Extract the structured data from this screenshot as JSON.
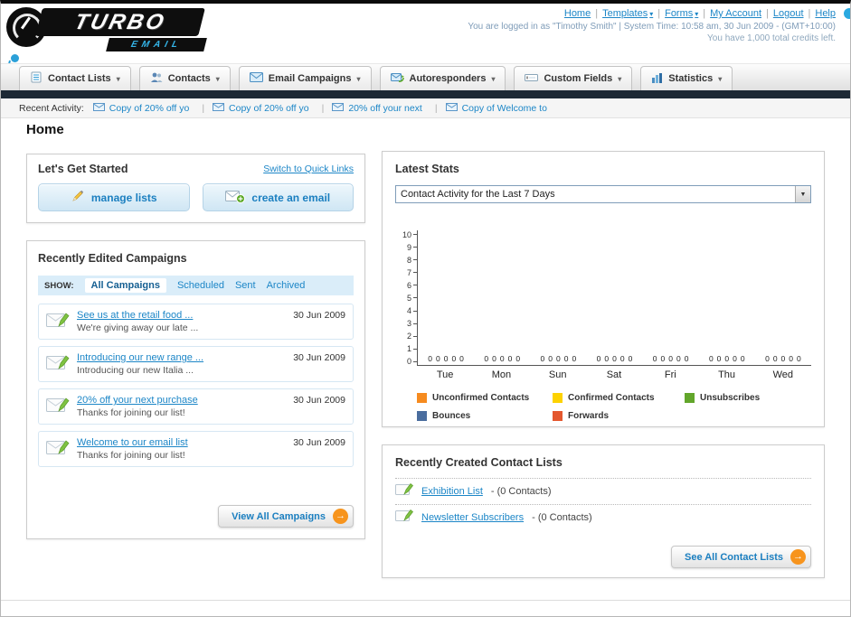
{
  "header": {
    "logo_title": "TURBO",
    "logo_subtitle": "EMAIL",
    "nav_links": [
      "Home",
      "Templates",
      "Forms",
      "My Account",
      "Logout",
      "Help"
    ],
    "login_info": "You are logged in as \"Timothy Smith\" | System Time: 10:58 am, 30 Jun 2009 - (GMT+10:00)",
    "credits_info": "You have 1,000 total credits left."
  },
  "nav_tabs": [
    {
      "label": "Contact Lists"
    },
    {
      "label": "Contacts"
    },
    {
      "label": "Email Campaigns"
    },
    {
      "label": "Autoresponders"
    },
    {
      "label": "Custom Fields"
    },
    {
      "label": "Statistics"
    }
  ],
  "recent_activity": {
    "label": "Recent Activity:",
    "items": [
      "Copy of 20% off yo",
      "Copy of 20% off yo",
      "20% off your next",
      "Copy of Welcome to"
    ]
  },
  "page_title": "Home",
  "get_started": {
    "title": "Let's Get Started",
    "switch_link": "Switch to Quick Links",
    "manage_lists_label": "manage lists",
    "create_email_label": "create an email"
  },
  "campaigns": {
    "title": "Recently Edited Campaigns",
    "show_label": "SHOW:",
    "filters": [
      "All Campaigns",
      "Scheduled",
      "Sent",
      "Archived"
    ],
    "active_filter": "All Campaigns",
    "rows": [
      {
        "title": "See us at the retail food ...",
        "subtitle": "We're giving away our late ...",
        "date": "30 Jun 2009"
      },
      {
        "title": "Introducing our new range ...",
        "subtitle": "Introducing our new Italia ...",
        "date": "30 Jun 2009"
      },
      {
        "title": "20% off your next purchase",
        "subtitle": "Thanks for joining our list!",
        "date": "30 Jun 2009"
      },
      {
        "title": "Welcome to our email list",
        "subtitle": "Thanks for joining our list!",
        "date": "30 Jun 2009"
      }
    ],
    "view_all_label": "View All Campaigns"
  },
  "latest_stats": {
    "title": "Latest Stats",
    "dropdown_value": "Contact Activity for the Last 7 Days",
    "legend": [
      {
        "label": "Unconfirmed Contacts",
        "color": "#f68b1f"
      },
      {
        "label": "Confirmed Contacts",
        "color": "#fdd200"
      },
      {
        "label": "Unsubscribes",
        "color": "#62a62b"
      },
      {
        "label": "Bounces",
        "color": "#4a6d9e"
      },
      {
        "label": "Forwards",
        "color": "#e4572e"
      }
    ]
  },
  "contact_lists": {
    "title": "Recently Created Contact Lists",
    "items": [
      {
        "name": "Exhibition List",
        "detail": "- (0 Contacts)"
      },
      {
        "name": "Newsletter Subscribers",
        "detail": "- (0 Contacts)"
      }
    ],
    "see_all_label": "See All Contact Lists"
  },
  "chart_data": {
    "type": "bar",
    "title": "Contact Activity for the Last 7 Days",
    "categories": [
      "Tue",
      "Mon",
      "Sun",
      "Sat",
      "Fri",
      "Thu",
      "Wed"
    ],
    "series": [
      {
        "name": "Unconfirmed Contacts",
        "color": "#f68b1f",
        "values": [
          0,
          0,
          0,
          0,
          0,
          0,
          0
        ]
      },
      {
        "name": "Confirmed Contacts",
        "color": "#fdd200",
        "values": [
          0,
          0,
          0,
          0,
          0,
          0,
          0
        ]
      },
      {
        "name": "Unsubscribes",
        "color": "#62a62b",
        "values": [
          0,
          0,
          0,
          0,
          0,
          0,
          0
        ]
      },
      {
        "name": "Bounces",
        "color": "#4a6d9e",
        "values": [
          0,
          0,
          0,
          0,
          0,
          0,
          0
        ]
      },
      {
        "name": "Forwards",
        "color": "#e4572e",
        "values": [
          0,
          0,
          0,
          0,
          0,
          0,
          0
        ]
      }
    ],
    "ylim": [
      0,
      10
    ],
    "y_ticks": [
      10,
      9,
      8,
      7,
      6,
      5,
      4,
      3,
      2,
      1,
      0
    ],
    "xlabel": "",
    "ylabel": "",
    "grid": false,
    "legend_position": "bottom"
  }
}
